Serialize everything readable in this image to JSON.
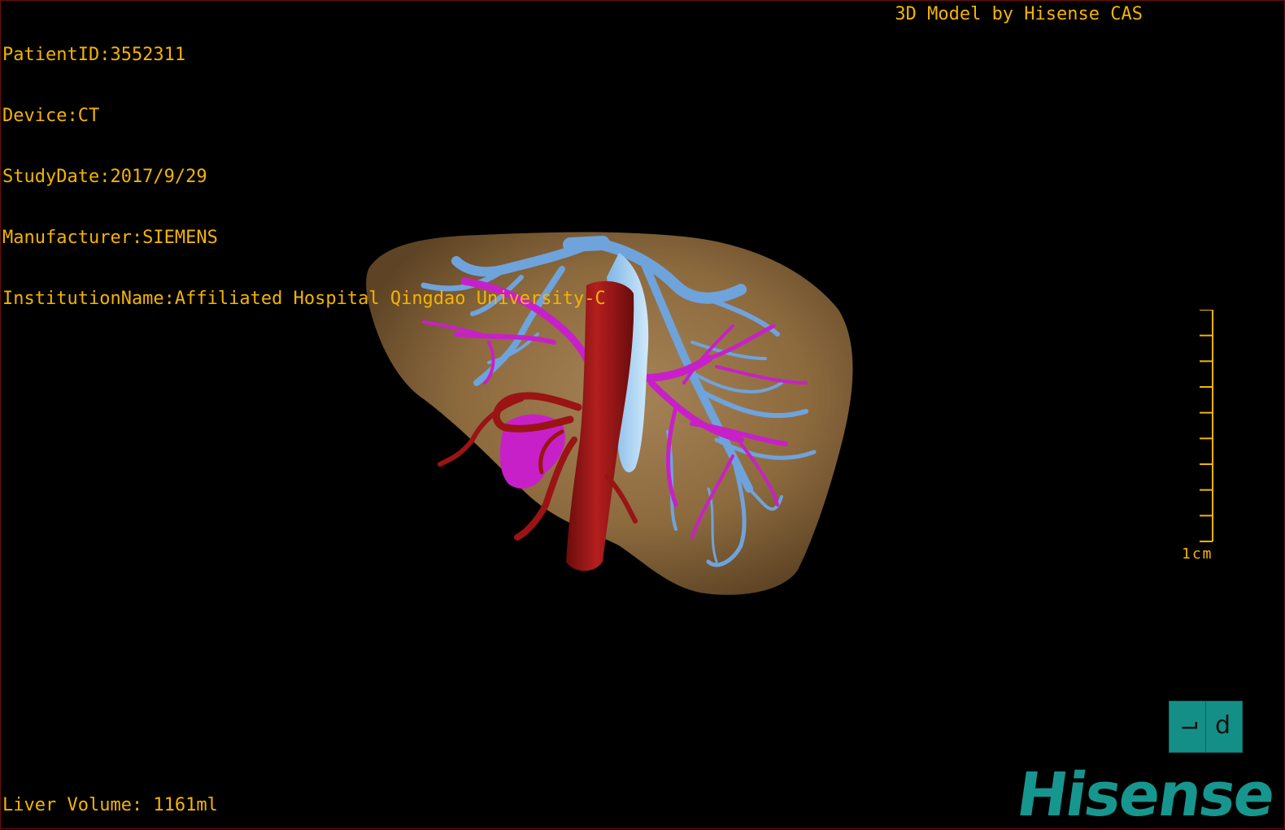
{
  "overlay": {
    "patient_id": "PatientID:3552311",
    "device": "Device:CT",
    "study_date": "StudyDate:2017/9/29",
    "manufacturer": "Manufacturer:SIEMENS",
    "institution": "InstitutionName:Affiliated Hospital Qingdao University-C",
    "credit": "3D Model by Hisense CAS",
    "liver_volume": "Liver Volume: 1161ml"
  },
  "scale": {
    "label": "1cm",
    "tick_count": 10
  },
  "orientation_cube": {
    "left_glyph": "⌐",
    "right_glyph": "d"
  },
  "brand": {
    "logo_text": "Hisense"
  },
  "colors": {
    "overlay_text": "#f4b400",
    "liver": "#8c6a3e",
    "hepatic_vein": "#6fa3dc",
    "portal_vein": "#c820c8",
    "ivc_artery": "#9a1414",
    "gallbladder": "#a7d2f0",
    "brand_teal": "#16968e"
  }
}
